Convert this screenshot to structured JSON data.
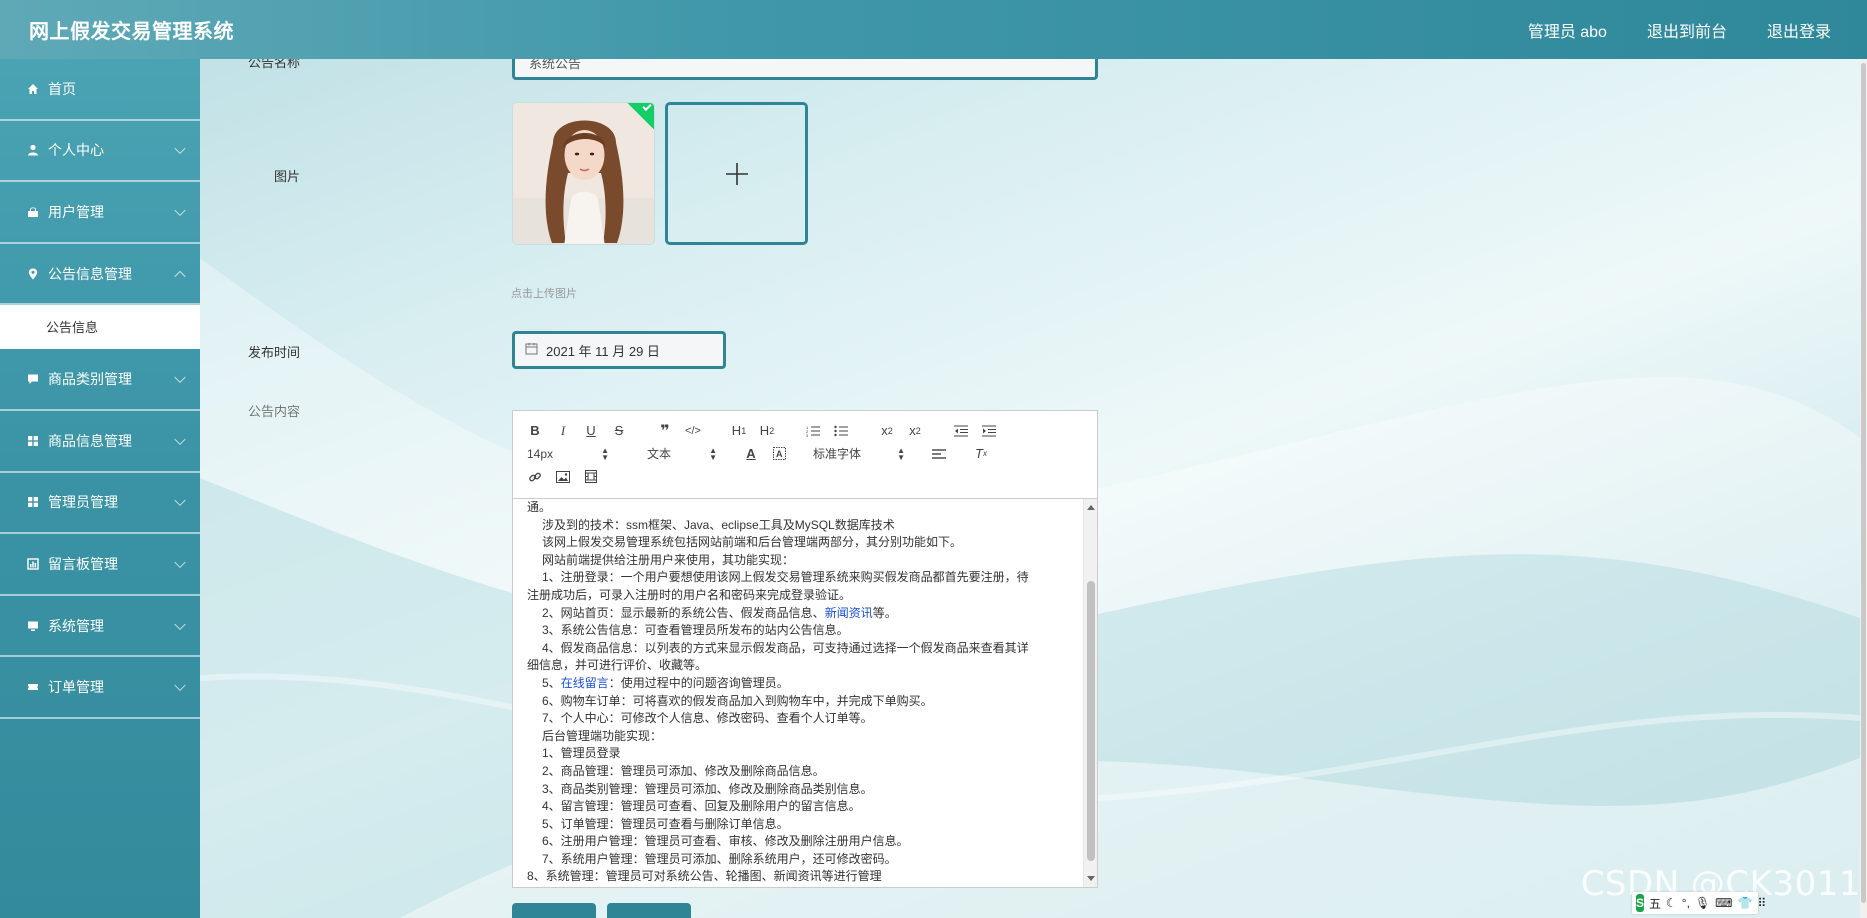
{
  "app": {
    "title": "网上假发交易管理系统"
  },
  "topnav": {
    "admin": "管理员 abo",
    "to_front": "退出到前台",
    "logout": "退出登录"
  },
  "sidebar": {
    "items": [
      {
        "label": "首页",
        "icon": "home-icon"
      },
      {
        "label": "个人中心",
        "icon": "user-icon"
      },
      {
        "label": "用户管理",
        "icon": "users-icon"
      },
      {
        "label": "公告信息管理",
        "icon": "location-pin-icon"
      },
      {
        "label": "商品类别管理",
        "icon": "chat-icon"
      },
      {
        "label": "商品信息管理",
        "icon": "grid-icon"
      },
      {
        "label": "管理员管理",
        "icon": "grid-icon"
      },
      {
        "label": "留言板管理",
        "icon": "chart-icon"
      },
      {
        "label": "系统管理",
        "icon": "monitor-icon"
      },
      {
        "label": "订单管理",
        "icon": "ticket-icon"
      }
    ],
    "sub_item": "公告信息"
  },
  "form": {
    "title_label": "公告名称",
    "title_value": "系统公告",
    "image_label": "图片",
    "upload_tip": "点击上传图片",
    "date_label": "发布时间",
    "date_value": "2021 年 11 月 29 日",
    "content_label": "公告内容"
  },
  "editor": {
    "font_size": "14px",
    "paragraph": "文本",
    "font_family": "标准字体",
    "lines": [
      {
        "text": "通。",
        "indent": false
      },
      {
        "text": "涉及到的技术：ssm框架、Java、eclipse工具及MySQL数据库技术",
        "indent": true
      },
      {
        "text": "该网上假发交易管理系统包括网站前端和后台管理端两部分，其分别功能如下。",
        "indent": true
      },
      {
        "text": "网站前端提供给注册用户来使用，其功能实现：",
        "indent": true
      },
      {
        "text": "1、注册登录：一个用户要想使用该网上假发交易管理系统来购买假发商品都首先要注册，待",
        "indent": true
      },
      {
        "text": "注册成功后，可录入注册时的用户名和密码来完成登录验证。",
        "indent": false
      },
      {
        "pre": "2、网站首页：显示最新的系统公告、假发商品信息、",
        "link": "新闻资讯",
        "post": "等。",
        "indent": true
      },
      {
        "text": "3、系统公告信息：可查看管理员所发布的站内公告信息。",
        "indent": true
      },
      {
        "text": "4、假发商品信息：以列表的方式来显示假发商品，可支持通过选择一个假发商品来查看其详",
        "indent": true
      },
      {
        "text": "细信息，并可进行评价、收藏等。",
        "indent": false
      },
      {
        "pre": "5、",
        "link": "在线留言",
        "post": "：使用过程中的问题咨询管理员。",
        "indent": true
      },
      {
        "text": "6、购物车订单：可将喜欢的假发商品加入到购物车中，并完成下单购买。",
        "indent": true
      },
      {
        "text": "7、个人中心：可修改个人信息、修改密码、查看个人订单等。",
        "indent": true
      },
      {
        "text": "后台管理端功能实现：",
        "indent": true
      },
      {
        "text": "1、管理员登录",
        "indent": true
      },
      {
        "text": "2、商品管理：管理员可添加、修改及删除商品信息。",
        "indent": true
      },
      {
        "text": "3、商品类别管理：管理员可添加、修改及删除商品类别信息。",
        "indent": true
      },
      {
        "text": "4、留言管理：管理员可查看、回复及删除用户的留言信息。",
        "indent": true
      },
      {
        "text": "5、订单管理：管理员可查看与删除订单信息。",
        "indent": true
      },
      {
        "text": "6、注册用户管理：管理员可查看、审核、修改及删除注册用户信息。",
        "indent": true
      },
      {
        "text": "7、系统用户管理：管理员可添加、删除系统用户，还可修改密码。",
        "indent": true
      },
      {
        "text": "8、系统管理：管理员可对系统公告、轮播图、新闻资讯等进行管理",
        "indent": false
      }
    ]
  },
  "watermark": "CSDN @CK3011",
  "ime": {
    "s": "S",
    "wubi": "五"
  },
  "colors": {
    "accent": "#2f8595",
    "header": "#3f97a9",
    "link": "#1a4fd6",
    "check": "#13ce66"
  }
}
